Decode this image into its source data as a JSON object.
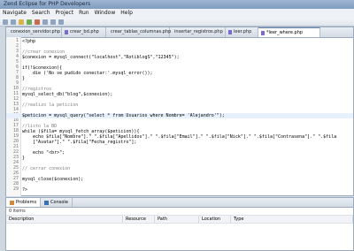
{
  "window": {
    "title": "Zend Eclipse for PHP Developers"
  },
  "menu": [
    "Navigate",
    "Search",
    "Project",
    "Run",
    "Window",
    "Help"
  ],
  "tabs": [
    {
      "label": "conexion_servidor.php",
      "active": false
    },
    {
      "label": "crear_bd.php",
      "active": false
    },
    {
      "label": "crear_tablas_columnas.php",
      "active": false
    },
    {
      "label": "insertar_registros.php",
      "active": false
    },
    {
      "label": "leer.php",
      "active": false
    },
    {
      "label": "*leer_where.php",
      "active": true
    }
  ],
  "code_lines": [
    {
      "n": "1",
      "text": "<?php"
    },
    {
      "n": "2",
      "text": ""
    },
    {
      "n": "3",
      "text": "//crear conexion"
    },
    {
      "n": "4",
      "text": "$conexion = mysql_connect(\"localhost\",\"RotiblogS\",\"12345\");"
    },
    {
      "n": "5",
      "text": ""
    },
    {
      "n": "6",
      "text": "if(!$conexion){"
    },
    {
      "n": "7",
      "text": "    die ('No se pudido conectar:'.mysql_error());"
    },
    {
      "n": "8",
      "text": "}"
    },
    {
      "n": "9",
      "text": ""
    },
    {
      "n": "10",
      "text": "//registros"
    },
    {
      "n": "11",
      "text": "mysql_select_db(\"blog\",$conexion);"
    },
    {
      "n": "12",
      "text": ""
    },
    {
      "n": "13",
      "text": "//realizo la peticion"
    },
    {
      "n": "14",
      "text": ""
    },
    {
      "n": "15",
      "text": "$peticion = mysql_query(\"select * from Usuarios where Nombre= 'Alejandro'\");"
    },
    {
      "n": "16",
      "text": ""
    },
    {
      "n": "17",
      "text": "//listo la BD"
    },
    {
      "n": "18",
      "text": "while ($fila= mysql_fetch_array($peticion)){"
    },
    {
      "n": "19",
      "text": "    echo $fila[\"Nombre\"].\" \".$fila[\"Apellidos\"].\" \".$fila[\"Email\"].\" \".$fila[\"Nick\"].\" \".$fila[\"Contrasena\"].\" \".$fila"
    },
    {
      "n": "20",
      "text": "    [\"Avatar\"].\" \".$fila[\"Fecha_registro\"];"
    },
    {
      "n": "21",
      "text": ""
    },
    {
      "n": "22",
      "text": "    echo \"<br>\";"
    },
    {
      "n": "23",
      "text": "}"
    },
    {
      "n": "24",
      "text": ""
    },
    {
      "n": "25",
      "text": "// cerrar conexion"
    },
    {
      "n": "26",
      "text": ""
    },
    {
      "n": "27",
      "text": "mysql_close($conexion);"
    },
    {
      "n": "28",
      "text": ""
    },
    {
      "n": "29",
      "text": "?>"
    }
  ],
  "highlight_line": "15",
  "panel": {
    "tabs": [
      {
        "label": "Problems",
        "icon": "problems-icon",
        "active": true
      },
      {
        "label": "Console",
        "icon": "console-icon",
        "active": false
      }
    ],
    "count": "0 items",
    "columns": [
      "Description",
      "Resource",
      "Path",
      "Location",
      "Type"
    ]
  },
  "colors": {
    "comment": "#7f7f7f",
    "string": "#2a00ff",
    "highlight": "#e8f0fb"
  }
}
